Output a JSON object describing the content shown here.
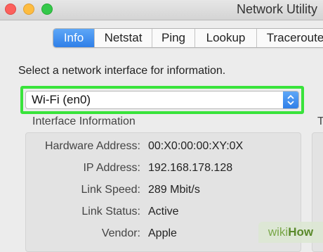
{
  "window": {
    "title": "Network Utility"
  },
  "tabs": [
    {
      "label": "Info",
      "active": true
    },
    {
      "label": "Netstat",
      "active": false
    },
    {
      "label": "Ping",
      "active": false
    },
    {
      "label": "Lookup",
      "active": false
    },
    {
      "label": "Traceroute",
      "active": false
    }
  ],
  "prompt": "Select a network interface for information.",
  "interface_select": {
    "selected": "Wi-Fi (en0)"
  },
  "interface_info": {
    "title": "Interface Information",
    "rows": [
      {
        "label": "Hardware Address:",
        "value": "00:X0:00:00:XY:0X"
      },
      {
        "label": "IP Address:",
        "value": "192.168.178.128"
      },
      {
        "label": "Link Speed:",
        "value": "289 Mbit/s"
      },
      {
        "label": "Link Status:",
        "value": "Active"
      },
      {
        "label": "Vendor:",
        "value": "Apple"
      }
    ]
  },
  "right_panel": {
    "title_fragment": "T"
  },
  "watermark": {
    "part1": "wiki",
    "part2": "How"
  },
  "colors": {
    "accent_blue": "#2f7fe8",
    "highlight_green": "#39e33b",
    "close": "#fc605c",
    "minimize": "#fdbc40",
    "zoom": "#34c84a"
  }
}
